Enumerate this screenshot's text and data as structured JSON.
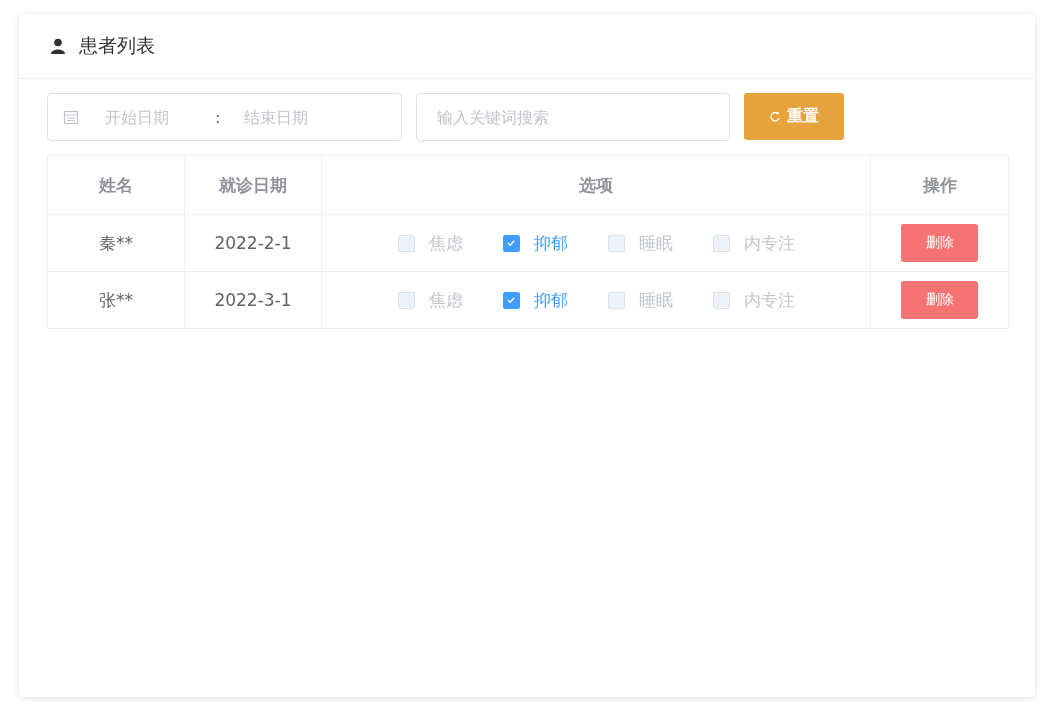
{
  "card": {
    "title": "患者列表"
  },
  "filters": {
    "start_placeholder": "开始日期",
    "separator": ":",
    "end_placeholder": "结束日期",
    "search_placeholder": "输入关键词搜索",
    "reset_button": "重置"
  },
  "table": {
    "columns": [
      "姓名",
      "就诊日期",
      "选项",
      "操作"
    ],
    "rows": [
      {
        "name": "秦**",
        "date": "2022-2-1",
        "options": [
          {
            "label": "焦虑",
            "checked": false
          },
          {
            "label": "抑郁",
            "checked": true
          },
          {
            "label": "睡眠",
            "checked": false
          },
          {
            "label": "内专注",
            "checked": false
          }
        ],
        "action": "删除"
      },
      {
        "name": "张**",
        "date": "2022-3-1",
        "options": [
          {
            "label": "焦虑",
            "checked": false
          },
          {
            "label": "抑郁",
            "checked": true
          },
          {
            "label": "睡眠",
            "checked": false
          },
          {
            "label": "内专注",
            "checked": false
          }
        ],
        "action": "删除"
      }
    ]
  }
}
